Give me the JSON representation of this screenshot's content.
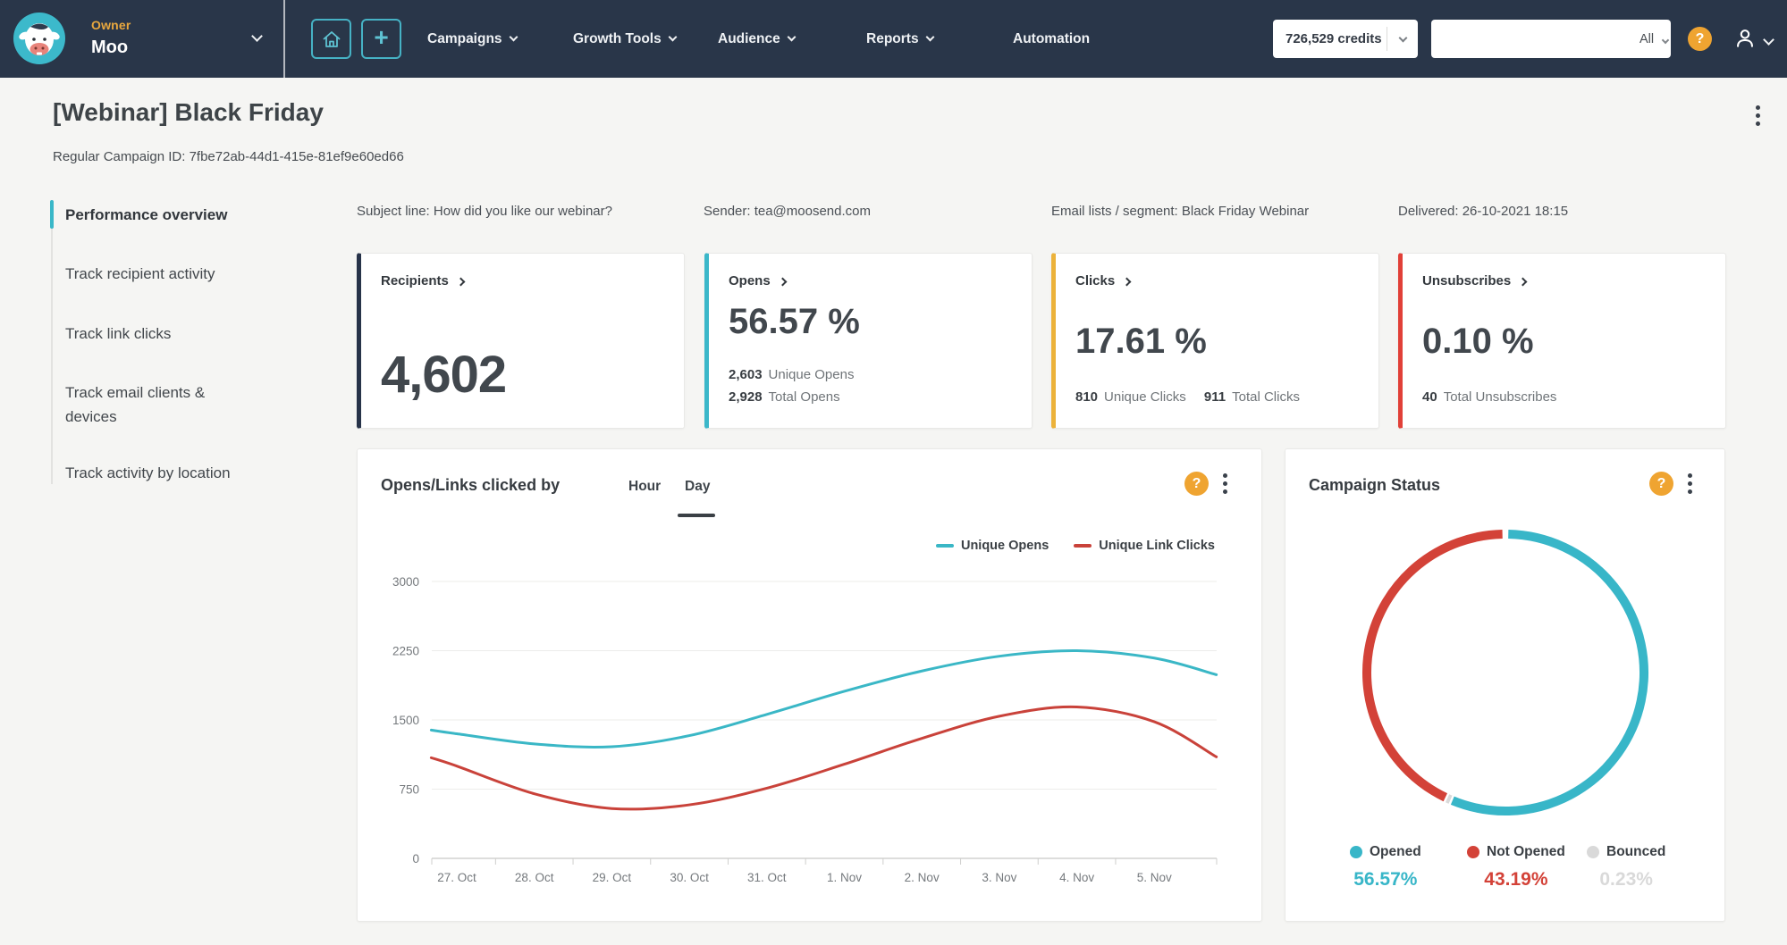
{
  "navbar": {
    "owner_label": "Owner",
    "account_name": "Moo",
    "items": [
      "Campaigns",
      "Growth Tools",
      "Audience",
      "Reports",
      "Automation"
    ],
    "credits": "726,529 credits",
    "search_filter": "All"
  },
  "icons": {
    "help": "?",
    "plus": "+"
  },
  "page": {
    "title": "[Webinar] Black Friday",
    "campaign_id": "Regular Campaign ID: 7fbe72ab-44d1-415e-81ef9e60ed66"
  },
  "sidebar": {
    "items": [
      {
        "label": "Performance overview",
        "active": true
      },
      {
        "label": "Track recipient activity",
        "active": false
      },
      {
        "label": "Track link clicks",
        "active": false
      },
      {
        "label": "Track email clients & devices",
        "active": false
      },
      {
        "label": "Track activity by location",
        "active": false
      }
    ]
  },
  "meta": {
    "subject": "Subject line: How did you like our webinar?",
    "sender": "Sender: tea@moosend.com",
    "lists": "Email lists / segment: Black Friday Webinar",
    "delivered": "Delivered: 26-10-2021 18:15"
  },
  "cards": [
    {
      "title": "Recipients",
      "value": "4,602",
      "accent": "#273349",
      "stats": []
    },
    {
      "title": "Opens",
      "value": "56.57 %",
      "accent": "#3bb7c9",
      "stats": [
        {
          "num": "2,603",
          "label": "Unique Opens"
        },
        {
          "num": "2,928",
          "label": "Total Opens"
        }
      ]
    },
    {
      "title": "Clicks",
      "value": "17.61 %",
      "accent": "#ecb23a",
      "stats": [
        {
          "num": "810",
          "label": "Unique Clicks"
        },
        {
          "num": "911",
          "label": "Total Clicks"
        }
      ]
    },
    {
      "title": "Unsubscribes",
      "value": "0.10 %",
      "accent": "#e14038",
      "stats": [
        {
          "num": "40",
          "label": "Total Unsubscribes"
        }
      ]
    }
  ],
  "chart_data": [
    {
      "type": "line",
      "title": "Opens/Links clicked by",
      "tabs": [
        "Hour",
        "Day"
      ],
      "active_tab": "Day",
      "x_ticks": [
        "27. Oct",
        "28. Oct",
        "29. Oct",
        "30. Oct",
        "31. Oct",
        "1. Nov",
        "2. Nov",
        "3. Nov",
        "4. Nov",
        "5. Nov"
      ],
      "ylim": [
        0,
        3000
      ],
      "yticks": [
        0,
        750,
        1500,
        2250,
        3000
      ],
      "grid": "horizontal",
      "legend_position": "top-right",
      "series": [
        {
          "name": "Unique Opens",
          "color": "#3ab7c6",
          "x": [
            -0.33,
            0,
            1,
            2,
            3,
            4,
            5,
            6,
            7,
            8,
            9,
            9.8
          ],
          "values": [
            1390,
            1350,
            1240,
            1210,
            1330,
            1560,
            1810,
            2030,
            2190,
            2250,
            2170,
            1990
          ]
        },
        {
          "name": "Unique Link Clicks",
          "color": "#c9423a",
          "x": [
            -0.33,
            0,
            1,
            2,
            3,
            4,
            5,
            6,
            7,
            8,
            9,
            9.8
          ],
          "values": [
            1090,
            1000,
            700,
            540,
            580,
            760,
            1020,
            1300,
            1540,
            1640,
            1480,
            1100
          ]
        }
      ]
    },
    {
      "type": "pie",
      "variant": "donut",
      "title": "Campaign Status",
      "legend_position": "bottom",
      "draw_sequence": [
        0,
        2,
        1
      ],
      "slices": [
        {
          "label": "Opened",
          "value": 56.57,
          "display": "56.57%",
          "color": "#38b6c8"
        },
        {
          "label": "Not Opened",
          "value": 43.19,
          "display": "43.19%",
          "color": "#d34238"
        },
        {
          "label": "Bounced",
          "value": 0.23,
          "display": "0.23%",
          "color": "#d9d9d9"
        }
      ]
    }
  ]
}
